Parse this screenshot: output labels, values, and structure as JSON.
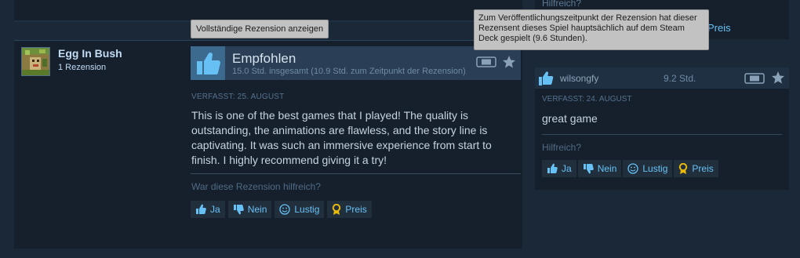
{
  "tooltip_full_review": "Vollständige Rezension anzeigen",
  "tooltip_deck": "Zum Veröffentlichungszeitpunkt der Rezension hat dieser Rezensent dieses Spiel hauptsächlich auf dem Steam Deck gespielt (9.6 Stunden).",
  "top_right": {
    "helpful_hint": "Hilfreich?",
    "fragment": "Preis"
  },
  "review": {
    "author_name": "Egg In Bush",
    "author_reviews": "1 Rezension",
    "recommendation": "Empfohlen",
    "hours": "15.0 Std. insgesamt (10.9 Std. zum Zeitpunkt der Rezension)",
    "posted": "VERFASST: 25. AUGUST",
    "text": "This is one of the best games that I played! The quality is outstanding, the animations are flawless, and the story line is captivating. It was such an immersive experience from start to finish. I highly recommend giving it a try!",
    "helpful_question": "War diese Rezension hilfreich?",
    "buttons": {
      "yes": "Ja",
      "no": "Nein",
      "funny": "Lustig",
      "award": "Preis"
    }
  },
  "short_review": {
    "author_name": "wilsongfy",
    "hours": "9.2 Std.",
    "posted": "VERFASST: 24. AUGUST",
    "text": "great game",
    "helpful_question": "Hilfreich?",
    "buttons": {
      "yes": "Ja",
      "no": "Nein",
      "funny": "Lustig",
      "award": "Preis"
    }
  },
  "colors": {
    "background": "#1b2838",
    "link": "#67c1f5",
    "award": "#e8b80d"
  }
}
